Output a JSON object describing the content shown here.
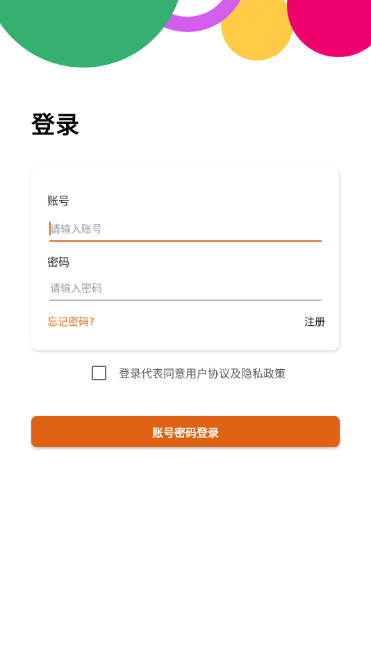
{
  "header": {
    "title": "登录"
  },
  "form": {
    "account_label": "账号",
    "account_placeholder": "请输入账号",
    "password_label": "密码",
    "password_placeholder": "请输入密码",
    "forgot_password": "忘记密码?",
    "register": "注册"
  },
  "agreement": {
    "text": "登录代表同意用户协议及隐私政策",
    "checked": false
  },
  "login_button": "账号密码登录",
  "colors": {
    "accent": "#de6211",
    "decor_green": "#34b170",
    "decor_purple": "#d45ded",
    "decor_yellow": "#ffcb47",
    "decor_pink": "#f0006e"
  }
}
